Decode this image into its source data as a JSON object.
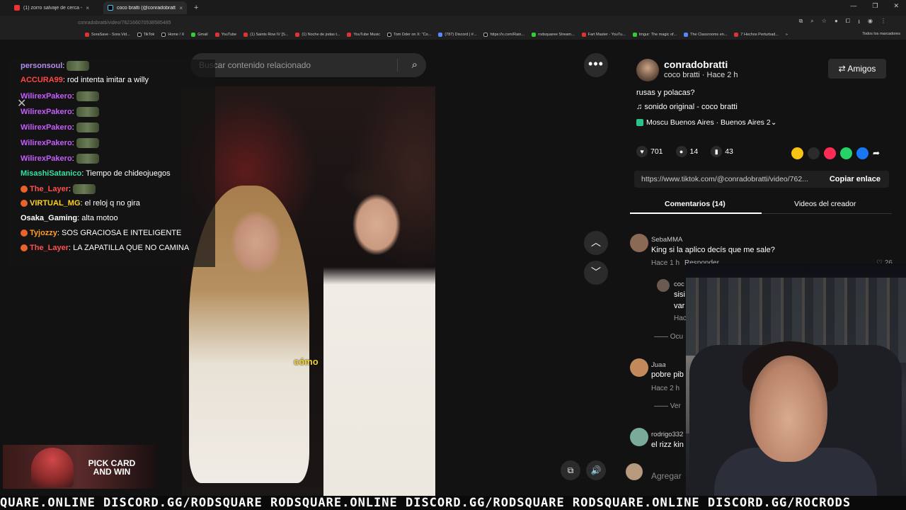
{
  "browser": {
    "tabs": [
      {
        "label": "(1) zorro salvaje de cerca - YouT",
        "close": "×"
      },
      {
        "label": "coco bratti (@conradobratti",
        "close": "×"
      }
    ],
    "new_tab": "+",
    "window_controls": [
      "—",
      "❐",
      "✕"
    ],
    "address_partial": "conradobratti/video/762166070538585485",
    "bookmarks": [
      "SoraSave - Sora Vid...",
      "TikTok",
      "Home / X",
      "Gmail",
      "YouTube",
      "(1) Saints Row IV [S...",
      "(1) Noche de jodas t...",
      "YouTube Music",
      "Tom Dder on X: \"Co...",
      "(787) Discord | #...",
      "https://x.com/Rain...",
      "rodsquaree Stream...",
      "Fart Master - YouTu...",
      "Imgur: The magic of...",
      "The Classrooms en...",
      "7 Hechos Perturbad..."
    ],
    "bookmarks_more": "»",
    "all_bookmarks": "Todos los marcadores"
  },
  "search": {
    "placeholder": "Buscar contenido relacionado"
  },
  "video": {
    "caption": "cómo"
  },
  "chat": [
    {
      "user": "personsoul",
      "color": "#b48ef0",
      "msg": "",
      "emote": true
    },
    {
      "user": "ACCURA99",
      "color": "#ff4747",
      "msg": "rod intenta imitar a willy",
      "emote": false
    },
    {
      "user": "WilirexPakero",
      "color": "#c85bff",
      "msg": "",
      "emote": true
    },
    {
      "user": "WilirexPakero",
      "color": "#c85bff",
      "msg": "",
      "emote": true
    },
    {
      "user": "WilirexPakero",
      "color": "#c85bff",
      "msg": "",
      "emote": true
    },
    {
      "user": "WilirexPakero",
      "color": "#c85bff",
      "msg": "",
      "emote": true
    },
    {
      "user": "WilirexPakero",
      "color": "#c85bff",
      "msg": "",
      "emote": true
    },
    {
      "user": "MisashiSatanico",
      "color": "#36e0a0",
      "msg": "Tiempo de chideojuegos",
      "emote": false
    },
    {
      "user": "The_Layer",
      "color": "#ff5050",
      "msg": "",
      "emote": true
    },
    {
      "user": "VIRTUAL_MG",
      "color": "#ffd21a",
      "msg": "el reloj q no gira",
      "emote": false
    },
    {
      "user": "Osaka_Gaming",
      "color": "#ffffff",
      "msg": "alta motoo",
      "emote": false
    },
    {
      "user": "Tyjozzy",
      "color": "#ff9f2a",
      "msg": "SOS GRACIOSA E INTELIGENTE",
      "emote": false
    },
    {
      "user": "The_Layer",
      "color": "#ff5050",
      "msg": "LA ZAPATILLA QUE NO CAMINA",
      "emote": false
    }
  ],
  "author": {
    "username": "conradobratti",
    "subline": "coco bratti · Hace 2 h",
    "friends_label": "Amigos",
    "description": "rusas y polacas?",
    "sound": "sonido original - coco bratti",
    "location": "Moscu Buenos Aires · Buenos Aires",
    "location_more": "2"
  },
  "stats": {
    "likes": "701",
    "comments": "14",
    "saves": "43"
  },
  "link": {
    "url": "https://www.tiktok.com/@conradobratti/video/762...",
    "copy_label": "Copiar enlace"
  },
  "tabs": {
    "comments": "Comentarios (14)",
    "creator": "Videos del creador"
  },
  "comments": [
    {
      "user": "SebaMMA",
      "text": "King si la aplico decís que me sale?",
      "time": "Hace 1 h",
      "reply": "Responder",
      "likes": "26"
    },
    {
      "user": "coc",
      "text": "sisi",
      "text2": "var",
      "time": "Hac"
    },
    {
      "hidden": "Ocu"
    },
    {
      "user": "Juaa",
      "text": "pobre pib",
      "time": "Hace 2 h"
    },
    {
      "more": "Ver"
    },
    {
      "user": "rodrigo332",
      "text": "el rizz kin"
    }
  ],
  "add_comment": "Agregar",
  "pick_card": {
    "line1": "PICK CARD",
    "line2": "AND WIN"
  },
  "ticker": "QUARE.ONLINE DISCORD.GG/RODSQUARE RODSQUARE.ONLINE DISCORD.GG/RODSQUARE RODSQUARE.ONLINE DISCORD.GG/ROCRODS",
  "colors": {
    "accent_like": "#ff2d55",
    "share_yellow": "#f7c315",
    "share_red": "#fe2c55",
    "share_green": "#25d366",
    "share_blue": "#1877f2"
  }
}
